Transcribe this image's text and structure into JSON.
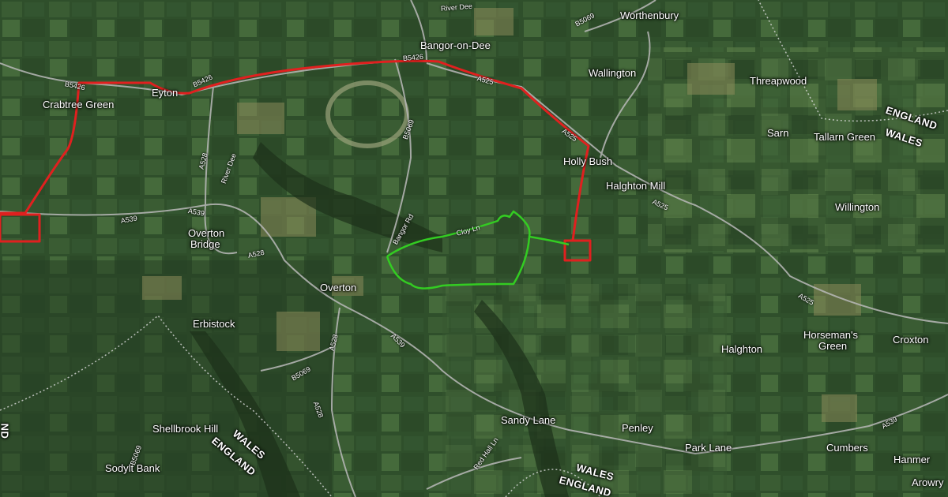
{
  "map": {
    "type": "satellite",
    "places": [
      {
        "id": "worthenbury",
        "name": "Worthenbury"
      },
      {
        "id": "bangor-on-dee",
        "name": "Bangor-on-Dee"
      },
      {
        "id": "wallington",
        "name": "Wallington"
      },
      {
        "id": "threapwood",
        "name": "Threapwood"
      },
      {
        "id": "crabtree-green",
        "name": "Crabtree Green"
      },
      {
        "id": "eyton",
        "name": "Eyton"
      },
      {
        "id": "sarn",
        "name": "Sarn"
      },
      {
        "id": "tallarn-green",
        "name": "Tallarn Green"
      },
      {
        "id": "holly-bush",
        "name": "Holly Bush"
      },
      {
        "id": "halghton-mill",
        "name": "Halghton Mill"
      },
      {
        "id": "willington",
        "name": "Willington"
      },
      {
        "id": "overton-bridge-1",
        "name": "Overton"
      },
      {
        "id": "overton-bridge-2",
        "name": "Bridge"
      },
      {
        "id": "overton",
        "name": "Overton"
      },
      {
        "id": "erbistock",
        "name": "Erbistock"
      },
      {
        "id": "horsemans-green-1",
        "name": "Horseman's"
      },
      {
        "id": "horsemans-green-2",
        "name": "Green"
      },
      {
        "id": "halghton",
        "name": "Halghton"
      },
      {
        "id": "croxton",
        "name": "Croxton"
      },
      {
        "id": "sandy-lane",
        "name": "Sandy Lane"
      },
      {
        "id": "penley",
        "name": "Penley"
      },
      {
        "id": "shellbrook-hill",
        "name": "Shellbrook Hill"
      },
      {
        "id": "park-lane",
        "name": "Park Lane"
      },
      {
        "id": "cumbers",
        "name": "Cumbers"
      },
      {
        "id": "hanmer",
        "name": "Hanmer"
      },
      {
        "id": "sodylt-bank",
        "name": "Sodylt Bank"
      },
      {
        "id": "arowry",
        "name": "Arowry"
      }
    ],
    "borders": [
      {
        "id": "england-ne",
        "name": "ENGLAND"
      },
      {
        "id": "wales-ne",
        "name": "WALES"
      },
      {
        "id": "wales-sw",
        "name": "WALES"
      },
      {
        "id": "england-sw",
        "name": "ENGLAND"
      },
      {
        "id": "wales-s",
        "name": "WALES"
      },
      {
        "id": "england-s",
        "name": "ENGLAND"
      },
      {
        "id": "cut-left",
        "name": "ND"
      }
    ],
    "roads": [
      {
        "id": "b5426-a",
        "name": "B5426"
      },
      {
        "id": "b5426-b",
        "name": "B5426"
      },
      {
        "id": "b5426-c",
        "name": "B5426"
      },
      {
        "id": "b5069-n",
        "name": "B5069"
      },
      {
        "id": "a525-a",
        "name": "A525"
      },
      {
        "id": "a525-b",
        "name": "A525"
      },
      {
        "id": "a525-c",
        "name": "A525"
      },
      {
        "id": "a525-d",
        "name": "A525"
      },
      {
        "id": "a528-n",
        "name": "A528"
      },
      {
        "id": "river-dee-1",
        "name": "River Dee"
      },
      {
        "id": "river-dee-2",
        "name": "River Dee"
      },
      {
        "id": "b5069-m",
        "name": "B5069"
      },
      {
        "id": "a539-a",
        "name": "A539"
      },
      {
        "id": "a539-b",
        "name": "A539"
      },
      {
        "id": "a539-c",
        "name": "A539"
      },
      {
        "id": "a539-d",
        "name": "A539"
      },
      {
        "id": "bangor-rd",
        "name": "Bangor Rd"
      },
      {
        "id": "cloy-ln",
        "name": "Cloy Ln"
      },
      {
        "id": "a528-m",
        "name": "A528"
      },
      {
        "id": "a528-s1",
        "name": "A528"
      },
      {
        "id": "a528-s2",
        "name": "A528"
      },
      {
        "id": "b5069-s",
        "name": "B5069"
      },
      {
        "id": "b5069-sw",
        "name": "B5069"
      },
      {
        "id": "red-hall-ln",
        "name": "Red Hall Ln"
      }
    ],
    "colors": {
      "route_red": "#e0201f",
      "route_green": "#33cc22",
      "road": "#b9b9b9"
    }
  }
}
